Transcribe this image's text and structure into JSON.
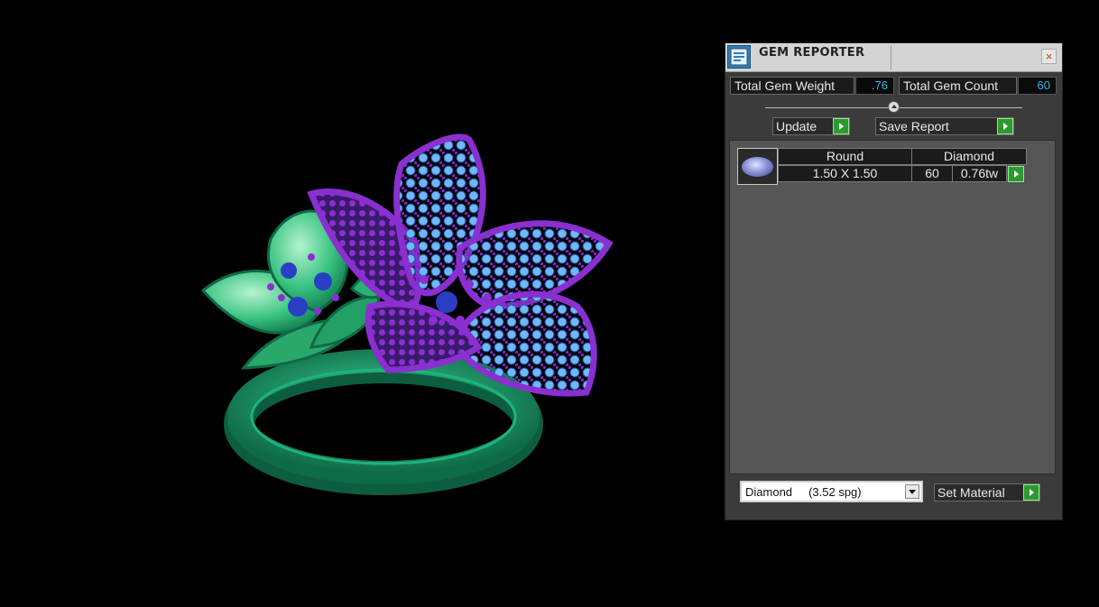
{
  "window": {
    "title": "GEM REPORTER",
    "close_label": "×"
  },
  "stats": {
    "weight_label": "Total Gem Weight",
    "weight_value": ".76",
    "count_label": "Total Gem Count",
    "count_value": "60"
  },
  "actions": {
    "update_label": "Update",
    "save_report_label": "Save Report"
  },
  "gem_table": {
    "rows": [
      {
        "shape": "Round",
        "material": "Diamond",
        "size": "1.50 X 1.50",
        "count": "60",
        "weight": "0.76tw"
      }
    ]
  },
  "material": {
    "selected": "Diamond     (3.52 spg)",
    "set_label": "Set Material"
  },
  "colors": {
    "metal_purple": "#7a22b8",
    "metal_green": "#1f9e6a",
    "gem_blue": "#3a7fd6",
    "accent_green": "#2e9a2e",
    "value_cyan": "#2ab7e8"
  }
}
